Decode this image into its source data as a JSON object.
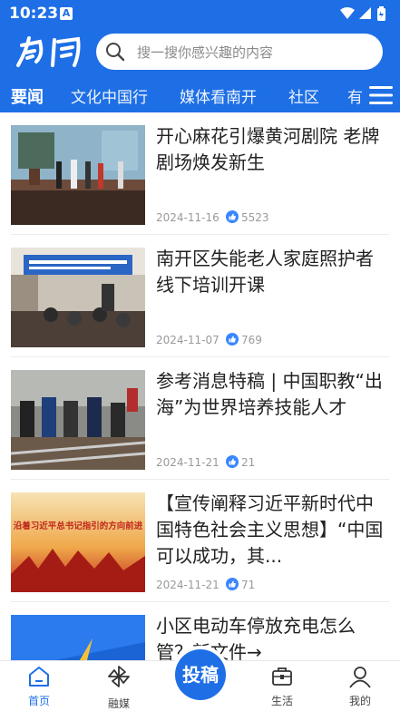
{
  "status": {
    "time": "10:23",
    "notif": "A"
  },
  "header": {
    "logo_text": "南開",
    "search_placeholder": "搜一搜你感兴趣的内容"
  },
  "tabs": [
    "要闻",
    "文化中国行",
    "媒体看南开",
    "社区",
    "有"
  ],
  "feed": [
    {
      "title": "开心麻花引爆黄河剧院 老牌剧场焕发新生",
      "date": "2024-11-16",
      "likes": "5523",
      "thumb_desc": "stage"
    },
    {
      "title": "南开区失能老人家庭照护者线下培训开课",
      "date": "2024-11-07",
      "likes": "769",
      "thumb_desc": "class"
    },
    {
      "title": "参考消息特稿 | 中国职教“出海”为世界培养技能人才",
      "date": "2024-11-21",
      "likes": "21",
      "thumb_desc": "rail"
    },
    {
      "title": "【宣传阐释习近平新时代中国特色社会主义思想】“中国可以成功，其...",
      "date": "2024-11-21",
      "likes": "71",
      "thumb_desc": "banner",
      "banner_text": "沿着习近平总书记指引的方向前进"
    },
    {
      "title": "小区电动车停放充电怎么管？新文件→",
      "date": "",
      "likes": "",
      "thumb_desc": "blue"
    }
  ],
  "bottom_nav": [
    {
      "label": "首页",
      "icon": "home-icon",
      "active": true
    },
    {
      "label": "融媒",
      "icon": "pinwheel-icon",
      "active": false
    },
    {
      "label": "投稿",
      "icon": "submit-button",
      "active": false
    },
    {
      "label": "生活",
      "icon": "briefcase-icon",
      "active": false
    },
    {
      "label": "我的",
      "icon": "user-icon",
      "active": false
    }
  ],
  "colors": {
    "brand": "#1e6fe6",
    "text": "#222222",
    "meta": "#9a9a9a",
    "like": "#3a86ff"
  }
}
